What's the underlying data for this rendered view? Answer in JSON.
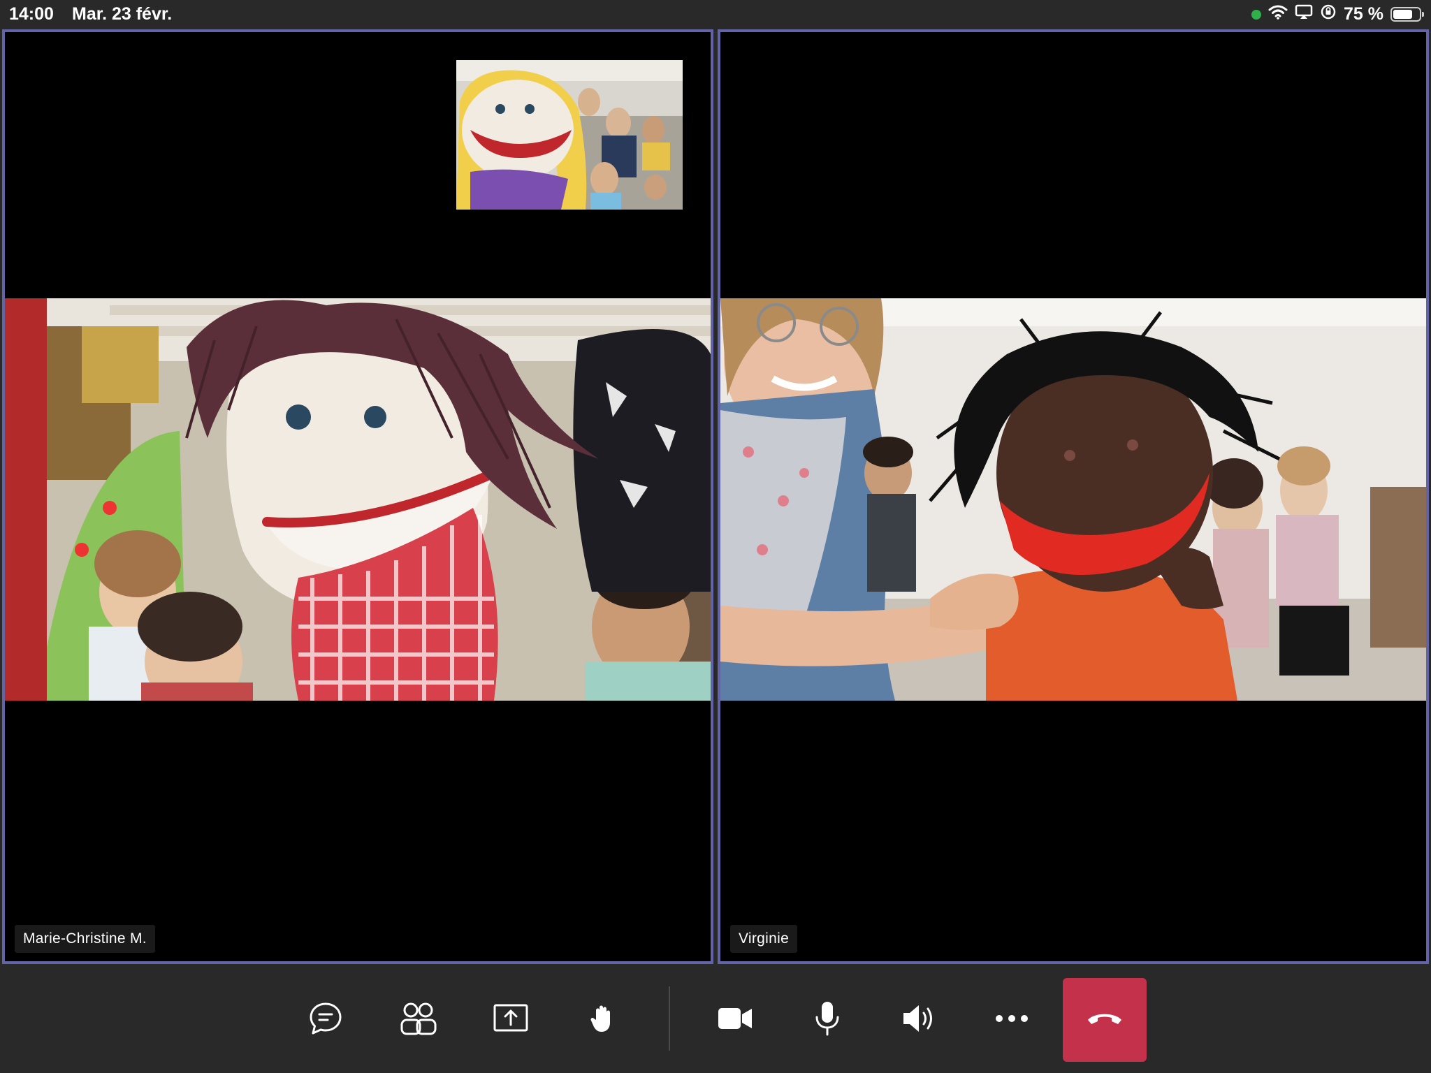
{
  "status_bar": {
    "time": "14:00",
    "date": "Mar. 23 févr.",
    "battery_percent": "75 %",
    "battery_level": 0.75,
    "icons": [
      "camera-active-dot",
      "wifi-icon",
      "airplay-icon",
      "orientation-lock-icon",
      "battery-icon"
    ]
  },
  "participants": [
    {
      "name": "Marie-Christine M."
    },
    {
      "name": "Virginie"
    }
  ],
  "controls": {
    "icons": [
      "chat-icon",
      "participants-icon",
      "share-screen-icon",
      "raise-hand-icon",
      "camera-icon",
      "microphone-icon",
      "speaker-icon",
      "more-icon",
      "hang-up-icon"
    ]
  },
  "colors": {
    "accent_border": "#6264a7",
    "hangup": "#c4314b",
    "background": "#292929"
  }
}
